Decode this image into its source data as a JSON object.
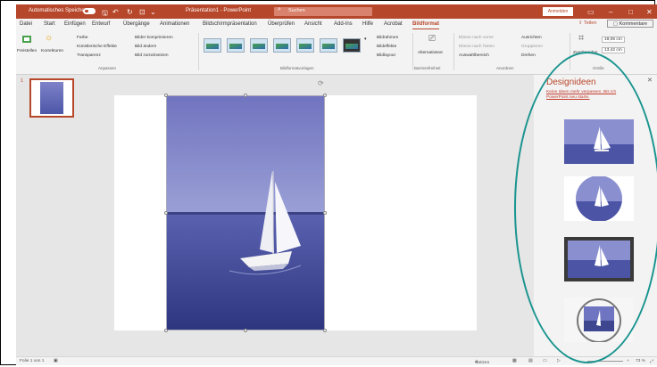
{
  "titlebar": {
    "autosave_label": "Automatisches Speichern",
    "doc_title": "Präsentation1 - PowerPoint",
    "search_placeholder": "Suchen",
    "signin_label": "Anmelden",
    "window_controls": [
      "restore-icon",
      "minimize-icon",
      "maximize-icon",
      "close-icon"
    ]
  },
  "tabs": [
    "Datei",
    "Start",
    "Einfügen",
    "Entwurf",
    "Übergänge",
    "Animationen",
    "Bildschirmpräsentation",
    "Überprüfen",
    "Ansicht",
    "Add-Ins",
    "Hilfe",
    "Acrobat",
    "Bildformat"
  ],
  "active_tab": "Bildformat",
  "share_label": "Teilen",
  "comments_label": "Kommentare",
  "ribbon": {
    "freistellen": "Freistellen",
    "korrekturen": "Korrekturen",
    "farbe": "Farbe",
    "kuenstlerische": "Künstlerische Effekte",
    "transparenz": "Transparenz",
    "bilder_komprimieren": "Bilder komprimieren",
    "bild_aendern": "Bild ändern",
    "bild_zuruecksetzen": "Bild zurücksetzen",
    "anpassen_label": "Anpassen",
    "bildformatvorlagen_label": "Bildformatvorlagen",
    "bildrahmen": "Bildrahmen",
    "bildeffekte": "Bildeffekte",
    "bildlayout": "Bildlayout",
    "alternativtext": "Alternativtext",
    "barrierefreiheit_label": "Barrierefreiheit",
    "ebene_nach_vorne": "Ebene nach vorne",
    "ebene_nach_hinten": "Ebene nach hinten",
    "auswahlbereich": "Auswahlbereich",
    "ausrichten": "Ausrichten",
    "gruppieren": "Gruppieren",
    "drehen": "Drehen",
    "anordnen_label": "Anordnen",
    "zuschneiden": "Zuschneiden",
    "height": "19,05 cm",
    "width": "13,42 cm",
    "groesse_label": "Größe"
  },
  "slide_number": "1",
  "design_pane": {
    "title": "Designideen",
    "link": "Keine Ideen mehr verpassen. Bis ich PowerPoint neu starte."
  },
  "status": {
    "slide_info": "Folie 1 von 1",
    "notes": "Notizen",
    "zoom": "73 %"
  },
  "colors": {
    "accent": "#b7472a",
    "ellipse": "#1a948f"
  }
}
